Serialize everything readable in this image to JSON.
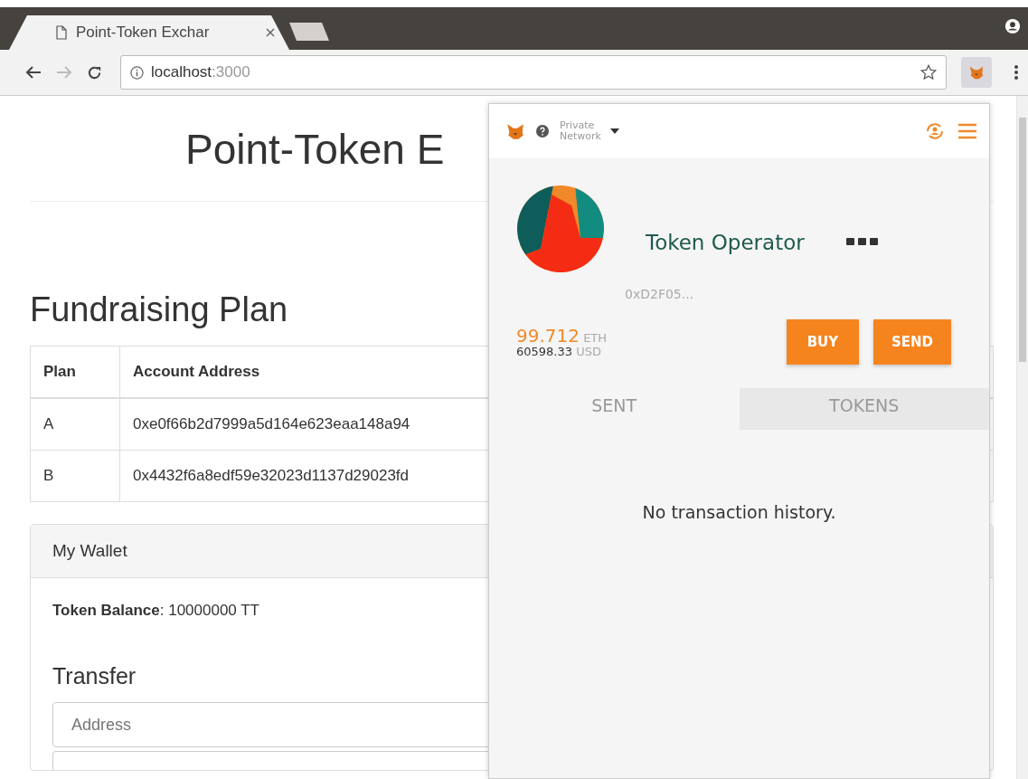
{
  "browser": {
    "tabs": [
      {
        "kind": "page",
        "title": "Point-Token Exchar",
        "selected": true
      },
      {
        "kind": "new",
        "selected": false
      }
    ],
    "address": {
      "host": "localhost",
      "port": ":3000"
    }
  },
  "page": {
    "title": "Point-Token E",
    "section_title": "Fundraising Plan",
    "table": {
      "columns": [
        "Plan",
        "Account Address"
      ],
      "rows": [
        {
          "plan": "A",
          "address": "0xe0f66b2d7999a5d164e623eaa148a94"
        },
        {
          "plan": "B",
          "address": "0x4432f6a8edf59e32023d1137d29023fd"
        }
      ]
    },
    "wallet": {
      "title": "My Wallet",
      "balance": "**Token Balance**: 10000000 TT",
      "transfer_title": "Transfer",
      "address_placeholder": "Address"
    }
  },
  "popup": {
    "network": [
      "Private",
      "Network"
    ],
    "account_name": "Token Operator",
    "account_address": "0xD2F05...",
    "eth_amount": "99.712",
    "eth_unit": "ETH",
    "usd_amount": "60598.33",
    "usd_unit": "USD",
    "buttons": [
      "BUY",
      "SEND"
    ],
    "tabs": [
      {
        "label": "SENT",
        "selected": true
      },
      {
        "label": "TOKENS",
        "selected": false
      }
    ],
    "empty_message": "No transaction history."
  }
}
